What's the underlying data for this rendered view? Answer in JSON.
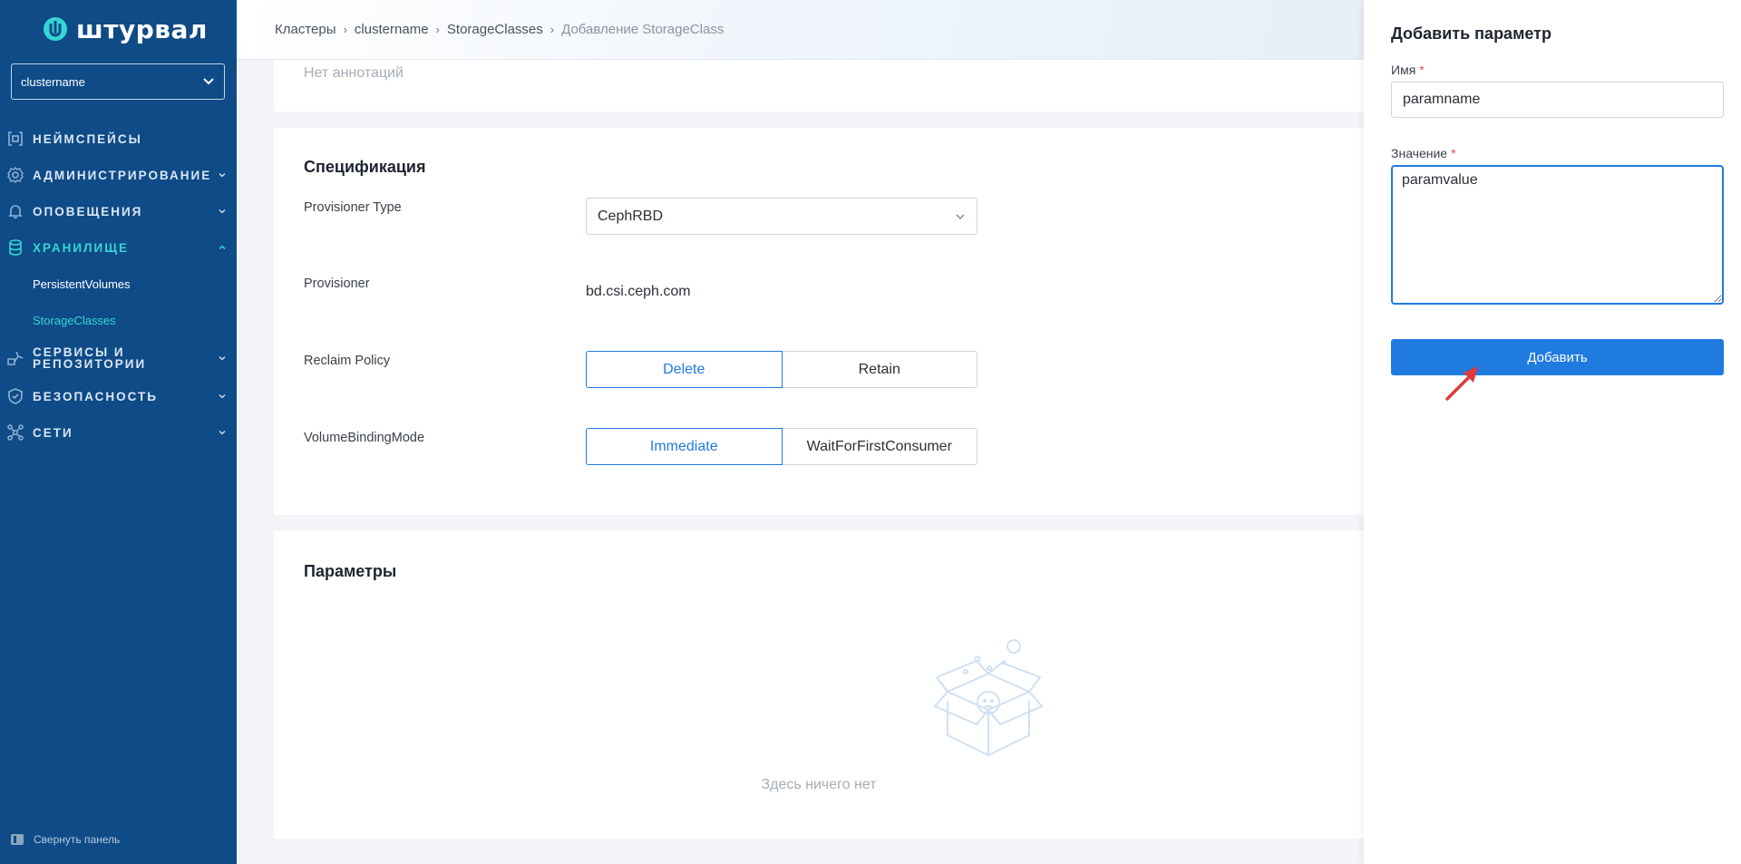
{
  "sidebar": {
    "brand": "штурвал",
    "cluster": "clustername",
    "nav": [
      {
        "label": "НЕЙМСПЕЙСЫ",
        "icon": "namespace-icon"
      },
      {
        "label": "АДМИНИСТРИРОВАНИЕ",
        "icon": "gear-icon"
      },
      {
        "label": "ОПОВЕЩЕНИЯ",
        "icon": "bell-icon"
      },
      {
        "label": "ХРАНИЛИЩЕ",
        "icon": "database-icon"
      },
      {
        "label": "СЕРВИСЫ И",
        "label2": "РЕПОЗИТОРИИ",
        "icon": "services-icon"
      },
      {
        "label": "БЕЗОПАСНОСТЬ",
        "icon": "shield-icon"
      },
      {
        "label": "СЕТИ",
        "icon": "network-icon"
      }
    ],
    "storage_sub": [
      "PersistentVolumes",
      "StorageClasses"
    ],
    "collapse_label": "Свернуть панель"
  },
  "breadcrumb": [
    "Кластеры",
    "clustername",
    "StorageClasses",
    "Добавление StorageClass"
  ],
  "annotations": {
    "empty": "Нет аннотаций"
  },
  "spec": {
    "title": "Спецификация",
    "provisioner_type_label": "Provisioner Type",
    "provisioner_type_value": "CephRBD",
    "provisioner_label": "Provisioner",
    "provisioner_value": "bd.csi.ceph.com",
    "reclaim_label": "Reclaim Policy",
    "reclaim_options": [
      "Delete",
      "Retain"
    ],
    "reclaim_selected": "Delete",
    "binding_label": "VolumeBindingMode",
    "binding_options": [
      "Immediate",
      "WaitForFirstConsumer"
    ],
    "binding_selected": "Immediate"
  },
  "params": {
    "title": "Параметры",
    "empty": "Здесь ничего нет"
  },
  "drawer": {
    "title": "Добавить параметр",
    "name_label": "Имя",
    "name_value": "paramname",
    "value_label": "Значение",
    "value_value": "paramvalue",
    "required_mark": "*",
    "submit": "Добавить"
  },
  "colors": {
    "sidebar": "#0e4b87",
    "accent": "#1f7be0",
    "active_nav": "#36d6d6",
    "required": "#e24b4b",
    "annotation": "#e03a3a"
  }
}
